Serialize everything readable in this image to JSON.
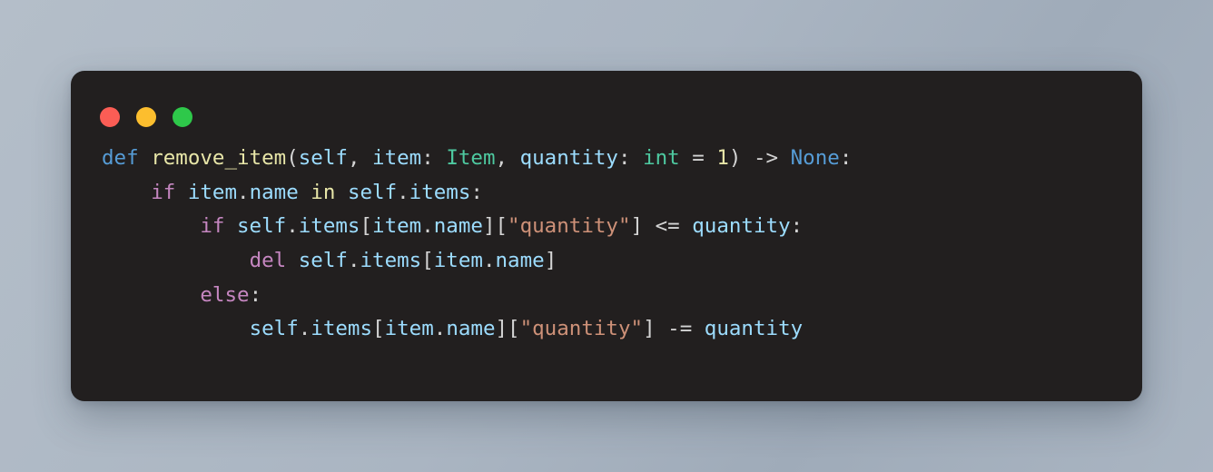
{
  "window": {
    "kind": "code-snippet-window",
    "background_color": "#221f1f",
    "page_background_colors": [
      "#b4bec9",
      "#9fabb9"
    ],
    "controls": [
      {
        "name": "close",
        "color": "#fb5d55",
        "label": ""
      },
      {
        "name": "minimize",
        "color": "#fcbe2e",
        "label": ""
      },
      {
        "name": "maximize",
        "color": "#2ec84a",
        "label": ""
      }
    ]
  },
  "palette": {
    "keyword": "#c586c0",
    "def_keyword": "#569cd6",
    "function_name": "#e8e6a8",
    "variable": "#9cdcfe",
    "type": "#4ec9a0",
    "string": "#ce9178",
    "number": "#e8e6a8",
    "operator": "#d4d4d4",
    "punctuation": "#d4d4d4",
    "builtin": "#569cd6",
    "plain": "#d4d4d4"
  },
  "code": {
    "language": "python",
    "full_text": "def remove_item(self, item: Item, quantity: int = 1) -> None:\n    if item.name in self.items:\n        if self.items[item.name][\"quantity\"] <= quantity:\n            del self.items[item.name]\n        else:\n            self.items[item.name][\"quantity\"] -= quantity",
    "lines": [
      {
        "indent": 0,
        "text": "def remove_item(self, item: Item, quantity: int = 1) -> None:",
        "tokens": [
          {
            "t": "def",
            "c": "def_keyword"
          },
          {
            "t": " ",
            "c": "plain"
          },
          {
            "t": "remove_item",
            "c": "function_name"
          },
          {
            "t": "(",
            "c": "punctuation"
          },
          {
            "t": "self",
            "c": "variable"
          },
          {
            "t": ", ",
            "c": "punctuation"
          },
          {
            "t": "item",
            "c": "variable"
          },
          {
            "t": ": ",
            "c": "punctuation"
          },
          {
            "t": "Item",
            "c": "type"
          },
          {
            "t": ", ",
            "c": "punctuation"
          },
          {
            "t": "quantity",
            "c": "variable"
          },
          {
            "t": ": ",
            "c": "punctuation"
          },
          {
            "t": "int",
            "c": "type"
          },
          {
            "t": " = ",
            "c": "operator"
          },
          {
            "t": "1",
            "c": "number"
          },
          {
            "t": ")",
            "c": "punctuation"
          },
          {
            "t": " -> ",
            "c": "operator"
          },
          {
            "t": "None",
            "c": "builtin"
          },
          {
            "t": ":",
            "c": "punctuation"
          }
        ]
      },
      {
        "indent": 4,
        "text": "    if item.name in self.items:",
        "tokens": [
          {
            "t": "    ",
            "c": "plain"
          },
          {
            "t": "if",
            "c": "keyword"
          },
          {
            "t": " ",
            "c": "plain"
          },
          {
            "t": "item",
            "c": "variable"
          },
          {
            "t": ".",
            "c": "punctuation"
          },
          {
            "t": "name",
            "c": "variable"
          },
          {
            "t": " ",
            "c": "plain"
          },
          {
            "t": "in",
            "c": "number"
          },
          {
            "t": " ",
            "c": "plain"
          },
          {
            "t": "self",
            "c": "variable"
          },
          {
            "t": ".",
            "c": "punctuation"
          },
          {
            "t": "items",
            "c": "variable"
          },
          {
            "t": ":",
            "c": "punctuation"
          }
        ]
      },
      {
        "indent": 8,
        "text": "        if self.items[item.name][\"quantity\"] <= quantity:",
        "tokens": [
          {
            "t": "        ",
            "c": "plain"
          },
          {
            "t": "if",
            "c": "keyword"
          },
          {
            "t": " ",
            "c": "plain"
          },
          {
            "t": "self",
            "c": "variable"
          },
          {
            "t": ".",
            "c": "punctuation"
          },
          {
            "t": "items",
            "c": "variable"
          },
          {
            "t": "[",
            "c": "punctuation"
          },
          {
            "t": "item",
            "c": "variable"
          },
          {
            "t": ".",
            "c": "punctuation"
          },
          {
            "t": "name",
            "c": "variable"
          },
          {
            "t": "][",
            "c": "punctuation"
          },
          {
            "t": "\"quantity\"",
            "c": "string"
          },
          {
            "t": "]",
            "c": "punctuation"
          },
          {
            "t": " <= ",
            "c": "operator"
          },
          {
            "t": "quantity",
            "c": "variable"
          },
          {
            "t": ":",
            "c": "punctuation"
          }
        ]
      },
      {
        "indent": 12,
        "text": "            del self.items[item.name]",
        "tokens": [
          {
            "t": "            ",
            "c": "plain"
          },
          {
            "t": "del",
            "c": "keyword"
          },
          {
            "t": " ",
            "c": "plain"
          },
          {
            "t": "self",
            "c": "variable"
          },
          {
            "t": ".",
            "c": "punctuation"
          },
          {
            "t": "items",
            "c": "variable"
          },
          {
            "t": "[",
            "c": "punctuation"
          },
          {
            "t": "item",
            "c": "variable"
          },
          {
            "t": ".",
            "c": "punctuation"
          },
          {
            "t": "name",
            "c": "variable"
          },
          {
            "t": "]",
            "c": "punctuation"
          }
        ]
      },
      {
        "indent": 8,
        "text": "        else:",
        "tokens": [
          {
            "t": "        ",
            "c": "plain"
          },
          {
            "t": "else",
            "c": "keyword"
          },
          {
            "t": ":",
            "c": "punctuation"
          }
        ]
      },
      {
        "indent": 12,
        "text": "            self.items[item.name][\"quantity\"] -= quantity",
        "tokens": [
          {
            "t": "            ",
            "c": "plain"
          },
          {
            "t": "self",
            "c": "variable"
          },
          {
            "t": ".",
            "c": "punctuation"
          },
          {
            "t": "items",
            "c": "variable"
          },
          {
            "t": "[",
            "c": "punctuation"
          },
          {
            "t": "item",
            "c": "variable"
          },
          {
            "t": ".",
            "c": "punctuation"
          },
          {
            "t": "name",
            "c": "variable"
          },
          {
            "t": "][",
            "c": "punctuation"
          },
          {
            "t": "\"quantity\"",
            "c": "string"
          },
          {
            "t": "]",
            "c": "punctuation"
          },
          {
            "t": " -= ",
            "c": "operator"
          },
          {
            "t": "quantity",
            "c": "variable"
          }
        ]
      }
    ]
  }
}
